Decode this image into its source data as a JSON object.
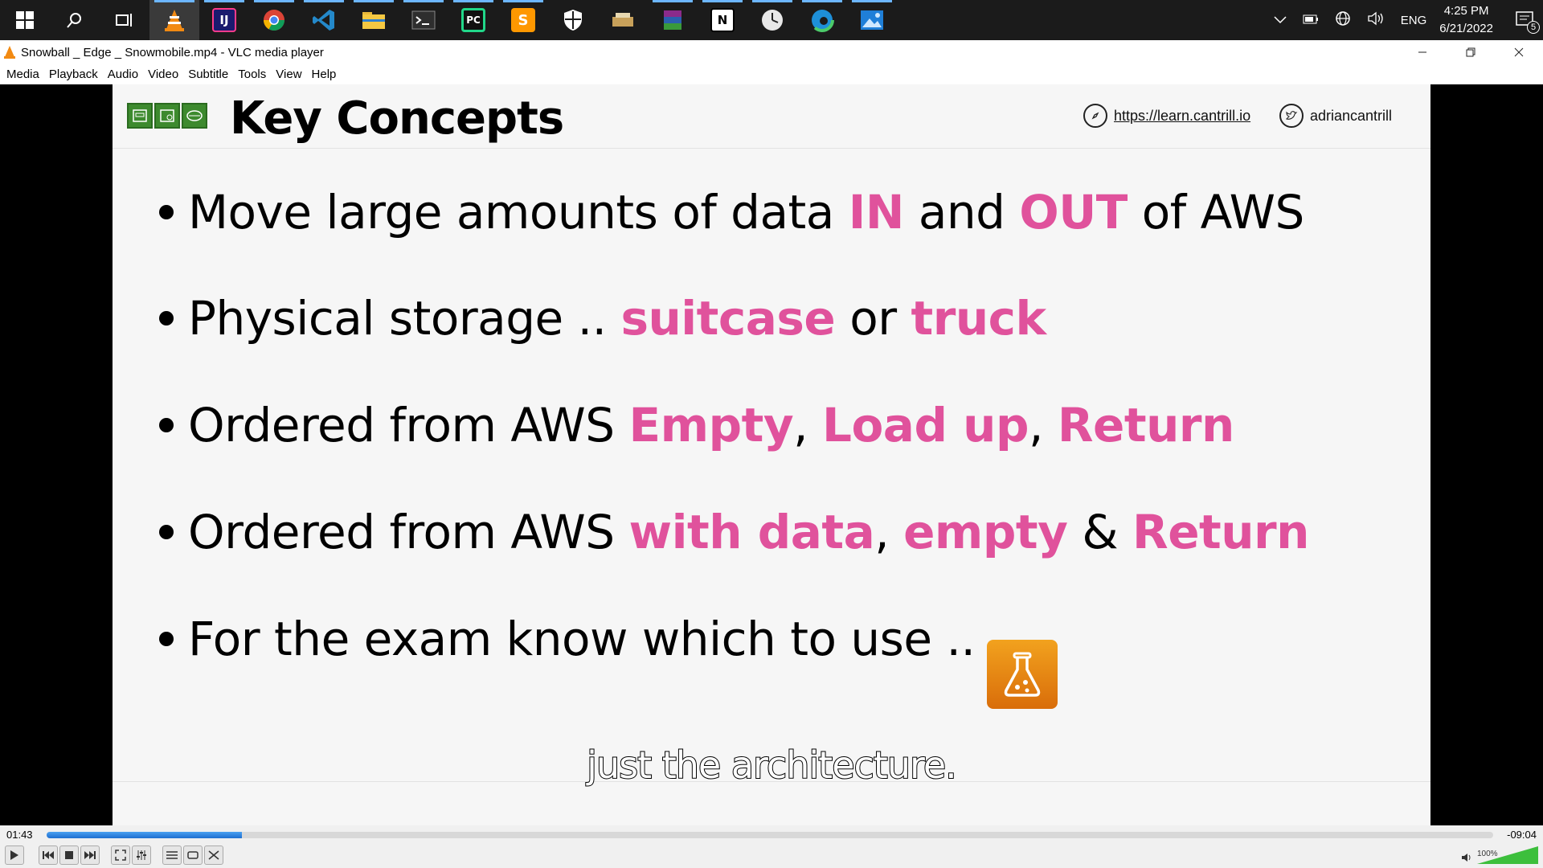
{
  "taskbar": {
    "apps": [
      {
        "name": "start-icon"
      },
      {
        "name": "search-icon"
      },
      {
        "name": "task-view-icon"
      },
      {
        "name": "vlc-icon"
      },
      {
        "name": "intellij-icon"
      },
      {
        "name": "chrome-icon"
      },
      {
        "name": "vscode-icon"
      },
      {
        "name": "file-explorer-icon"
      },
      {
        "name": "terminal-icon"
      },
      {
        "name": "pycharm-icon"
      },
      {
        "name": "sublime-icon"
      },
      {
        "name": "security-icon"
      },
      {
        "name": "app-icon"
      },
      {
        "name": "winrar-icon"
      },
      {
        "name": "notion-icon"
      },
      {
        "name": "clock-app-icon"
      },
      {
        "name": "edge-icon"
      },
      {
        "name": "photos-icon"
      }
    ],
    "tray": {
      "language": "ENG",
      "time": "4:25 PM",
      "date": "6/21/2022",
      "notifications": "5"
    }
  },
  "window": {
    "title": "Snowball _ Edge _ Snowmobile.mp4 - VLC media player"
  },
  "menu": [
    "Media",
    "Playback",
    "Audio",
    "Video",
    "Subtitle",
    "Tools",
    "View",
    "Help"
  ],
  "slide": {
    "title": "Key Concepts",
    "link": "https://learn.cantrill.io",
    "twitter": "adriancantrill",
    "bullets": [
      {
        "segments": [
          {
            "text": "Move large amounts of data ",
            "hl": false
          },
          {
            "text": "IN",
            "hl": true
          },
          {
            "text": " and ",
            "hl": false
          },
          {
            "text": "OUT",
            "hl": true
          },
          {
            "text": " of AWS",
            "hl": false
          }
        ]
      },
      {
        "segments": [
          {
            "text": "Physical storage .. ",
            "hl": false
          },
          {
            "text": "suitcase",
            "hl": true
          },
          {
            "text": " or ",
            "hl": false
          },
          {
            "text": "truck",
            "hl": true
          }
        ]
      },
      {
        "segments": [
          {
            "text": "Ordered from AWS ",
            "hl": false
          },
          {
            "text": "Empty",
            "hl": true
          },
          {
            "text": ", ",
            "hl": false
          },
          {
            "text": "Load up",
            "hl": true
          },
          {
            "text": ", ",
            "hl": false
          },
          {
            "text": "Return",
            "hl": true
          }
        ]
      },
      {
        "segments": [
          {
            "text": "Ordered from AWS ",
            "hl": false
          },
          {
            "text": "with data",
            "hl": true
          },
          {
            "text": ", ",
            "hl": false
          },
          {
            "text": "empty",
            "hl": true
          },
          {
            "text": " & ",
            "hl": false
          },
          {
            "text": "Return",
            "hl": true
          }
        ]
      },
      {
        "segments": [
          {
            "text": "For the exam know which to use ..",
            "hl": false
          }
        ]
      }
    ],
    "subtitle": "just the architecture."
  },
  "player": {
    "elapsed": "01:43",
    "remaining": "-09:04",
    "progress": 0.135,
    "volume_label": "100%",
    "volume": 1.0
  },
  "colors": {
    "highlight": "#e0529c",
    "seek": "#1f6fd0"
  }
}
